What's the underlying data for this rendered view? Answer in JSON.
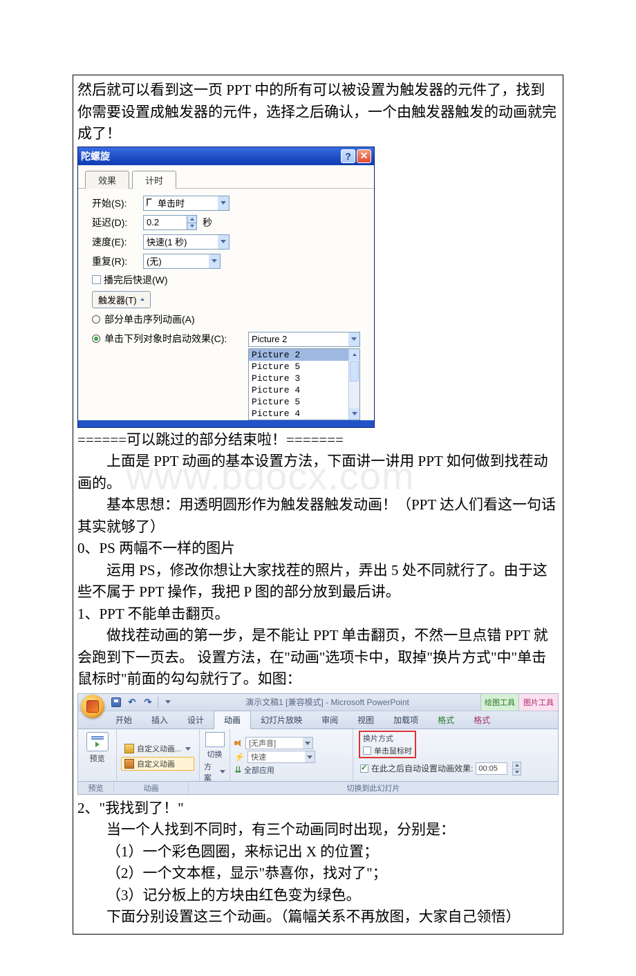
{
  "intro": {
    "p1": "然后就可以看到这一页 PPT 中的所有可以被设置为触发器的元件了，找到你需要设置成触发器的元件，选择之后确认，一个由触发器触发的动画就完成了！"
  },
  "dialog": {
    "title": "陀螺旋",
    "tabs": {
      "effect": "效果",
      "timing": "计时"
    },
    "labels": {
      "start": "开始(S):",
      "delay": "延迟(D):",
      "speed": "速度(E):",
      "repeat": "重复(R):",
      "seconds": "秒",
      "rewind": "播完后快退(W)",
      "trigger_btn": "触发器(T)",
      "seq_radio": "部分单击序列动画(A)",
      "click_radio": "单击下列对象时启动效果(C):"
    },
    "values": {
      "start": "单击时",
      "delay": "0.2",
      "speed": "快速(1 秒)",
      "repeat": "(无)",
      "trigger_selected": "Picture 2"
    },
    "options": [
      "Picture 2",
      "Picture 5",
      "Picture 3",
      "Picture 4",
      "Picture 5",
      "Picture 4"
    ]
  },
  "mid": {
    "skip_end": "======可以跳过的部分结束啦！=======",
    "p2": "上面是 PPT 动画的基本设置方法，下面讲一讲用 PPT 如何做到找茬动画的。",
    "p3": "基本思想：用透明圆形作为触发器触发动画！（PPT 达人们看这一句话其实就够了）",
    "h0": "0、PS 两幅不一样的图片",
    "p4": "运用 PS，修改你想让大家找茬的照片，弄出 5 处不同就行了。由于这些不属于 PPT 操作，我把 P 图的部分放到最后讲。",
    "h1": "1、PPT 不能单击翻页。",
    "p5": "做找茬动画的第一步，是不能让 PPT 单击翻页，不然一旦点错 PPT 就会跑到下一页去。 设置方法，在\"动画\"选项卡中，取掉\"换片方式\"中\"单击鼠标时\"前面的勾勾就行了。如图："
  },
  "ribbon": {
    "title_center": "演示文稿1 [兼容模式] - Microsoft PowerPoint",
    "tool_draw": "绘图工具",
    "tool_pic": "图片工具",
    "tabs": [
      "开始",
      "插入",
      "设计",
      "动画",
      "幻灯片放映",
      "审阅",
      "视图",
      "加载项",
      "格式",
      "格式"
    ],
    "preview_label": "预览",
    "anim_item1": "自定义动画...",
    "anim_item2": "自定义动画",
    "anim_group": "动画",
    "switch_btn_a": "切换",
    "switch_btn_b": "方案",
    "no_sound": "[无声音]",
    "speed": "快速",
    "apply_all": "全部应用",
    "transition_title": "换片方式",
    "on_click": "单击鼠标时",
    "auto_after": "在此之后自动设置动画效果:",
    "auto_time": "00:05",
    "footer_preview": "预览",
    "footer_anim": "动画",
    "footer_switch": "切换到此幻灯片"
  },
  "tail": {
    "h2": "2、\"我找到了！\"",
    "p6": "当一个人找到不同时，有三个动画同时出现，分别是：",
    "p7": "（1）一个彩色圆圈，来标记出 X 的位置；",
    "p8": "（2）一个文本框，显示\"恭喜你，找对了\"；",
    "p9": "（3）记分板上的方块由红色变为绿色。",
    "p10": "下面分别设置这三个动画。（篇幅关系不再放图，大家自己领悟）"
  },
  "watermark": "www.bdocx.com"
}
